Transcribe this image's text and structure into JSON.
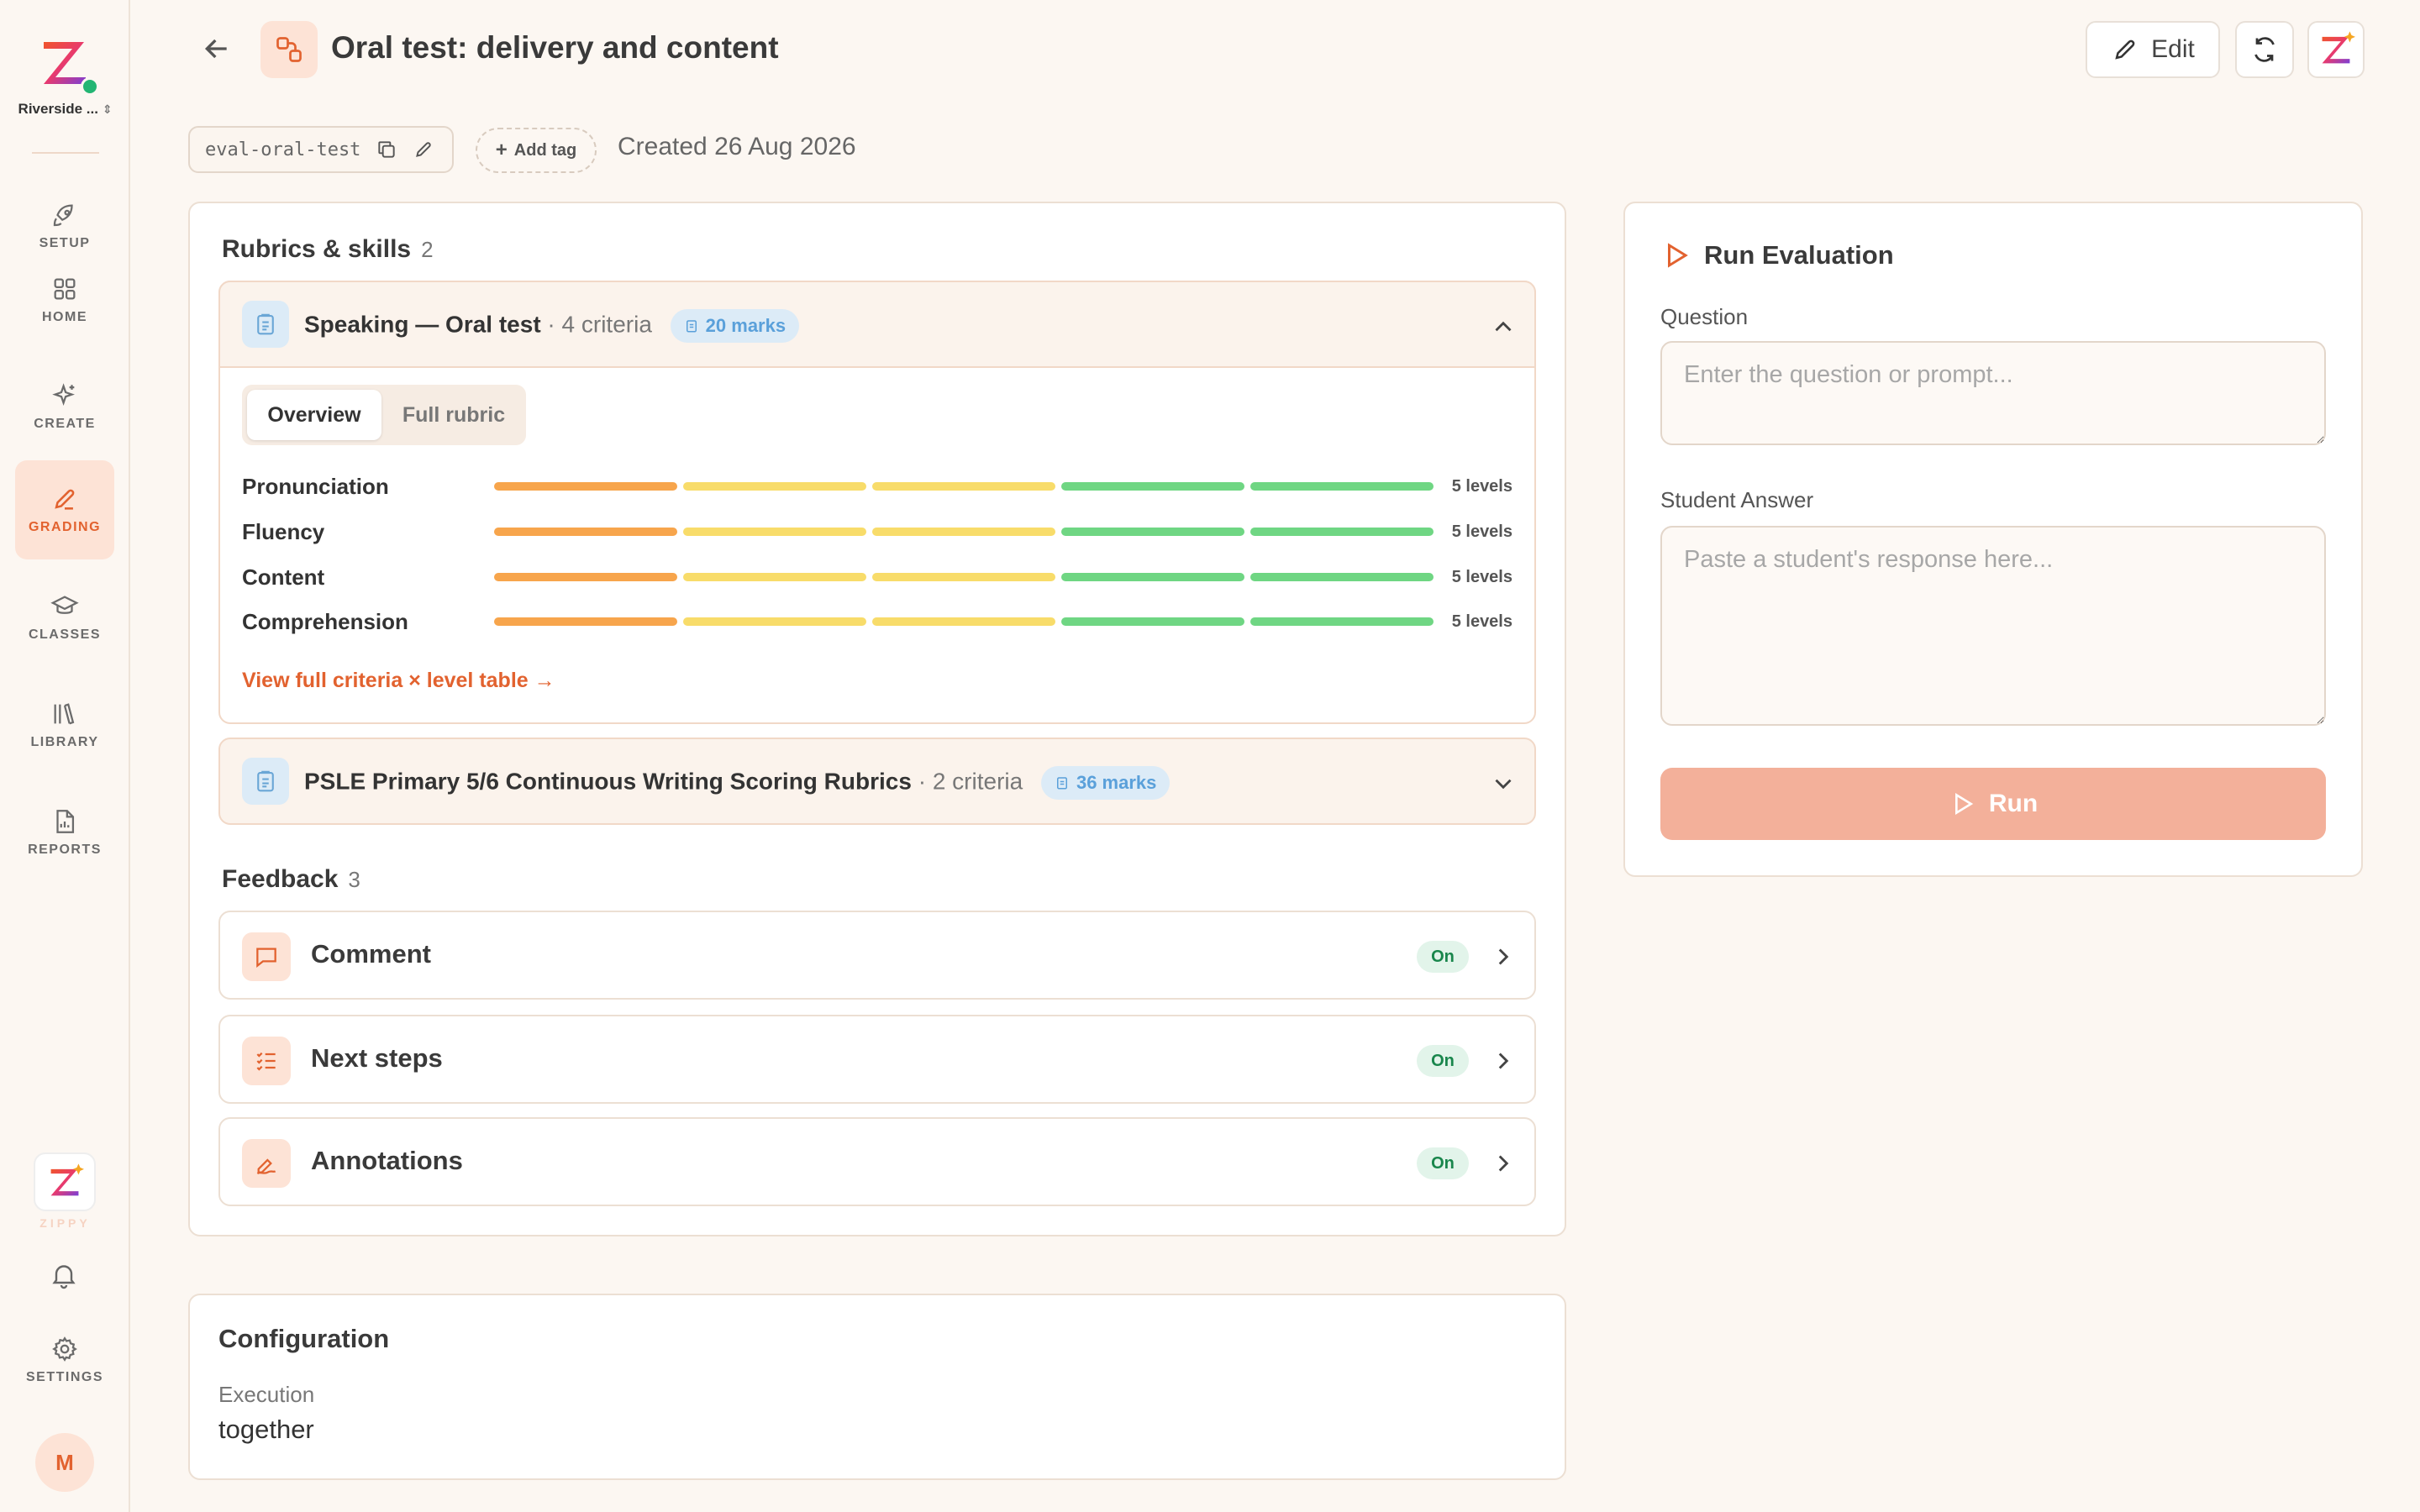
{
  "sidebar": {
    "org_name": "Riverside ...",
    "items": [
      {
        "label": "SETUP",
        "icon": "rocket-icon"
      },
      {
        "label": "HOME",
        "icon": "grid-icon"
      },
      {
        "label": "CREATE",
        "icon": "sparkles-icon"
      },
      {
        "label": "GRADING",
        "icon": "pencil-icon",
        "active": true
      },
      {
        "label": "CLASSES",
        "icon": "graduation-cap-icon"
      },
      {
        "label": "LIBRARY",
        "icon": "library-icon"
      },
      {
        "label": "REPORTS",
        "icon": "report-icon"
      }
    ],
    "zippy_label": "ZIPPY",
    "settings_label": "SETTINGS",
    "avatar_initial": "M"
  },
  "header": {
    "title": "Oral test: delivery and content",
    "edit_label": "Edit"
  },
  "meta": {
    "slug": "eval-oral-test",
    "add_tag_label": "Add tag",
    "created": "Created 26 Aug 2026"
  },
  "rubrics": {
    "title": "Rubrics & skills",
    "count": "2",
    "items": [
      {
        "name": "Speaking — Oral test",
        "criteria": "· 4 criteria",
        "marks": "20 marks",
        "expanded": true,
        "tabs": [
          "Overview",
          "Full rubric"
        ],
        "active_tab": "Overview",
        "criteria_list": [
          {
            "name": "Pronunciation",
            "levels": "5 levels"
          },
          {
            "name": "Fluency",
            "levels": "5 levels"
          },
          {
            "name": "Content",
            "levels": "5 levels"
          },
          {
            "name": "Comprehension",
            "levels": "5 levels"
          }
        ],
        "level_colors": [
          "#f7a54c",
          "#f8dc6a",
          "#f8dc6a",
          "#6fd683",
          "#6fd683"
        ],
        "view_link": "View full criteria × level table →"
      },
      {
        "name": "PSLE Primary 5/6 Continuous Writing Scoring Rubrics",
        "criteria": "· 2 criteria",
        "marks": "36 marks",
        "expanded": false
      }
    ]
  },
  "feedback": {
    "title": "Feedback",
    "count": "3",
    "items": [
      {
        "name": "Comment",
        "status": "On",
        "icon": "comment-icon"
      },
      {
        "name": "Next steps",
        "status": "On",
        "icon": "checklist-icon"
      },
      {
        "name": "Annotations",
        "status": "On",
        "icon": "annotation-icon"
      }
    ]
  },
  "configuration": {
    "title": "Configuration",
    "execution_label": "Execution",
    "execution_value": "together"
  },
  "run_panel": {
    "title": "Run Evaluation",
    "question_label": "Question",
    "question_placeholder": "Enter the question or prompt...",
    "answer_label": "Student Answer",
    "answer_placeholder": "Paste a student's response here...",
    "run_label": "Run"
  },
  "colors": {
    "accent": "#e2622f",
    "accent_soft": "#fde3d6",
    "run_button": "#f3b09a",
    "on_badge": "#19864c",
    "marks_badge": "#5aa0da"
  }
}
